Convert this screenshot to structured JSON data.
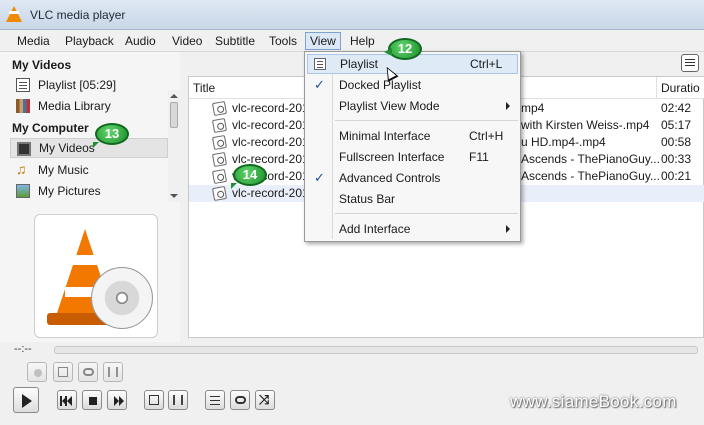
{
  "window": {
    "title": "VLC media player"
  },
  "menubar": [
    "Media",
    "Playback",
    "Audio",
    "Video",
    "Subtitle",
    "Tools",
    "View",
    "Help"
  ],
  "sidebar": {
    "section_my_videos": "My Videos",
    "playlist": "Playlist [05:29]",
    "media_library": "Media Library",
    "section_my_computer": "My Computer",
    "my_videos": "My Videos",
    "my_music": "My Music",
    "my_pictures": "My Pictures"
  },
  "playlist": {
    "columns": {
      "title": "Title",
      "duration": "Duratio"
    },
    "rows": [
      {
        "title": "vlc-record-201",
        "rest": "mp4",
        "duration": "02:42"
      },
      {
        "title": "vlc-record-201",
        "rest": "with Kirsten Weiss-.mp4",
        "duration": "05:17"
      },
      {
        "title": "vlc-record-201",
        "rest": "u HD.mp4-.mp4",
        "duration": "00:58"
      },
      {
        "title": "vlc-record-201",
        "rest": "Ascends - ThePianoGuy...",
        "duration": "00:33"
      },
      {
        "title": "vlc-record-201",
        "rest": "Ascends - ThePianoGuy...",
        "duration": "00:21"
      },
      {
        "title": "vlc-record-201",
        "rest": "",
        "duration": ""
      }
    ]
  },
  "view_menu": {
    "playlist": "Playlist",
    "playlist_shortcut": "Ctrl+L",
    "docked_playlist": "Docked Playlist",
    "playlist_view_mode": "Playlist View Mode",
    "minimal_interface": "Minimal Interface",
    "minimal_shortcut": "Ctrl+H",
    "fullscreen_interface": "Fullscreen Interface",
    "fullscreen_shortcut": "F11",
    "advanced_controls": "Advanced Controls",
    "status_bar": "Status Bar",
    "add_interface": "Add Interface",
    "check_mark": "✓"
  },
  "badges": {
    "b12": "12",
    "b13": "13",
    "b14": "14"
  },
  "seek": {
    "time": "--:--"
  },
  "watermark": "www.siameBook.com",
  "colors": {
    "menu_hover": "#dfeaf7",
    "badge_green": "#1e8e2e",
    "cone_orange": "#f27800"
  }
}
